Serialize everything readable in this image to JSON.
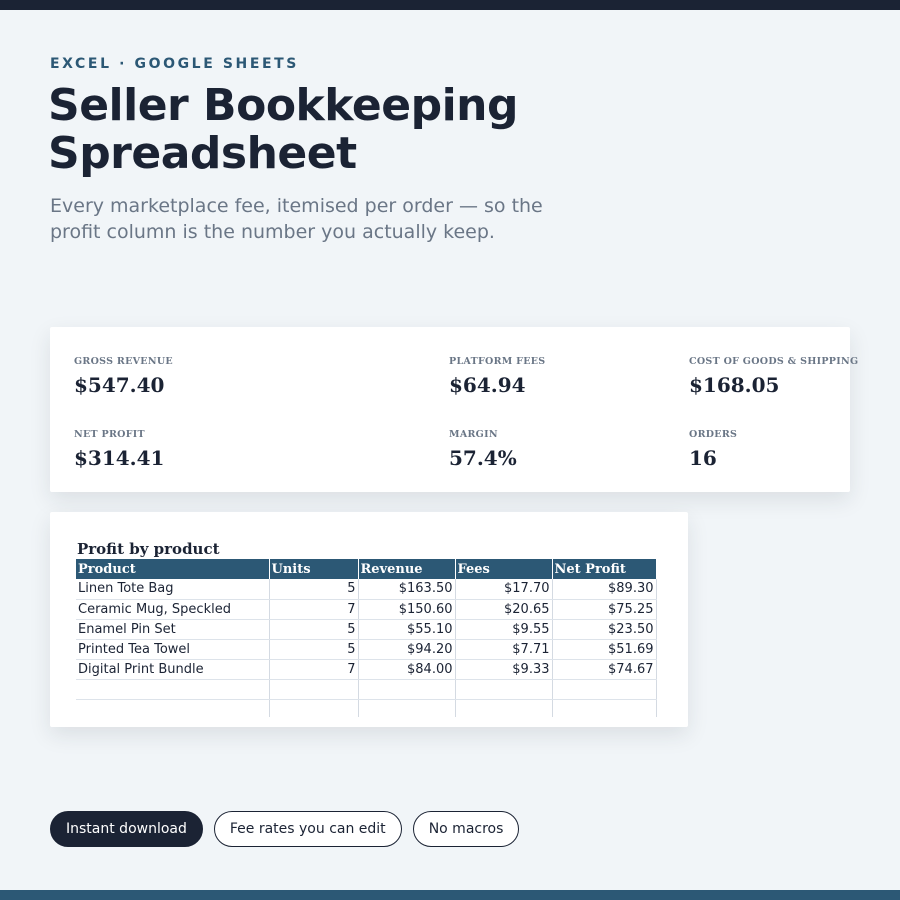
{
  "header": {
    "eyebrow": "EXCEL · GOOGLE SHEETS",
    "title": "Seller Bookkeeping Spreadsheet",
    "subtitle": "Every marketplace fee, itemised per order — so the profit column is the number you actually keep."
  },
  "stats": [
    {
      "label": "GROSS REVENUE",
      "value": "$547.40"
    },
    {
      "label": "PLATFORM FEES",
      "value": "$64.94"
    },
    {
      "label": "COST OF GOODS & SHIPPING",
      "value": "$168.05"
    },
    {
      "label": "NET PROFIT",
      "value": "$314.41"
    },
    {
      "label": "MARGIN",
      "value": "57.4%"
    },
    {
      "label": "ORDERS",
      "value": "16"
    }
  ],
  "sheet": {
    "title": "Profit by product",
    "columns": [
      "Product",
      "Units",
      "Revenue",
      "Fees",
      "Net Profit"
    ],
    "rows": [
      [
        "Linen Tote Bag",
        "5",
        "$163.50",
        "$17.70",
        "$89.30"
      ],
      [
        "Ceramic Mug, Speckled",
        "7",
        "$150.60",
        "$20.65",
        "$75.25"
      ],
      [
        "Enamel Pin Set",
        "5",
        "$55.10",
        "$9.55",
        "$23.50"
      ],
      [
        "Printed Tea Towel",
        "5",
        "$94.20",
        "$7.71",
        "$51.69"
      ],
      [
        "Digital Print Bundle",
        "7",
        "$84.00",
        "$9.33",
        "$74.67"
      ]
    ]
  },
  "tags": [
    {
      "label": "Instant download"
    },
    {
      "label": "Fee rates you can edit"
    },
    {
      "label": "No macros"
    }
  ],
  "colors": {
    "navy": "#1b2334",
    "accent": "#2c5875",
    "background": "#f1f5f8",
    "muted_text": "#6a7686"
  }
}
